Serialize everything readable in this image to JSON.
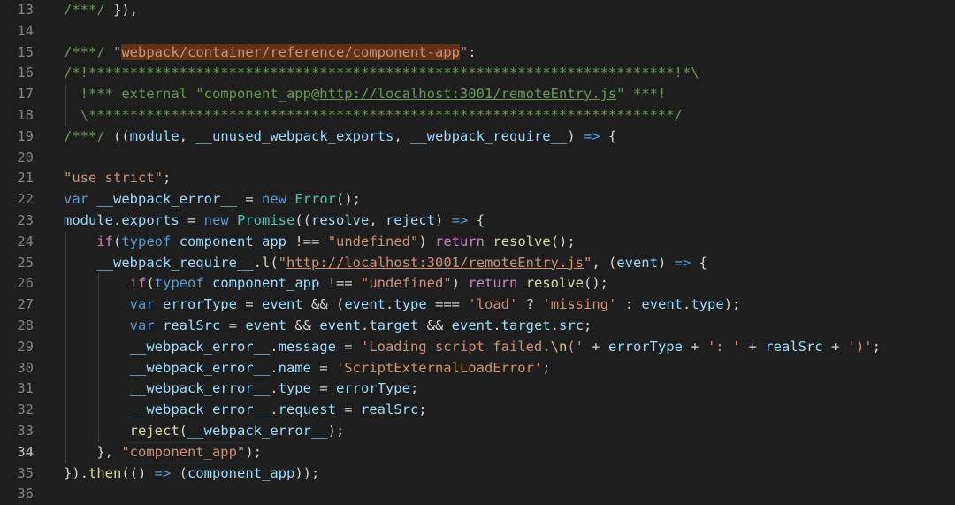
{
  "editor": {
    "lines": [
      {
        "n": "13",
        "parts": [
          [
            "c",
            "/***/ "
          ],
          [
            "p",
            "}),"
          ]
        ]
      },
      {
        "n": "14",
        "parts": []
      },
      {
        "n": "15",
        "parts": [
          [
            "c",
            "/***/ "
          ],
          [
            "s",
            "\""
          ],
          [
            "s hl",
            "webpack/container/reference/component-app"
          ],
          [
            "s",
            "\""
          ],
          [
            "p",
            ":"
          ]
        ]
      },
      {
        "n": "16",
        "parts": [
          [
            "c",
            "/*!***********************************************************************!*\\"
          ]
        ]
      },
      {
        "n": "17",
        "parts": [
          [
            "c",
            "  !*** external \"component_app@"
          ],
          [
            "c u",
            "http://localhost:3001/remoteEntry.js"
          ],
          [
            "c",
            "\" ***!"
          ]
        ]
      },
      {
        "n": "18",
        "parts": [
          [
            "c",
            "  \\***********************************************************************/"
          ]
        ]
      },
      {
        "n": "19",
        "parts": [
          [
            "c",
            "/***/ "
          ],
          [
            "p",
            "(("
          ],
          [
            "v",
            "module"
          ],
          [
            "p",
            ", "
          ],
          [
            "v",
            "__unused_webpack_exports"
          ],
          [
            "p",
            ", "
          ],
          [
            "v",
            "__webpack_require__"
          ],
          [
            "p",
            ") "
          ],
          [
            "k",
            "=>"
          ],
          [
            "p",
            " {"
          ]
        ]
      },
      {
        "n": "20",
        "parts": []
      },
      {
        "n": "21",
        "parts": [
          [
            "s",
            "\"use strict\""
          ],
          [
            "p",
            ";"
          ]
        ]
      },
      {
        "n": "22",
        "parts": [
          [
            "k",
            "var"
          ],
          [
            "p",
            " "
          ],
          [
            "v",
            "__webpack_error__"
          ],
          [
            "p",
            " = "
          ],
          [
            "k",
            "new"
          ],
          [
            "p",
            " "
          ],
          [
            "t",
            "Error"
          ],
          [
            "p",
            "();"
          ]
        ]
      },
      {
        "n": "23",
        "parts": [
          [
            "v",
            "module"
          ],
          [
            "p",
            "."
          ],
          [
            "v",
            "exports"
          ],
          [
            "p",
            " = "
          ],
          [
            "k",
            "new"
          ],
          [
            "p",
            " "
          ],
          [
            "t",
            "Promise"
          ],
          [
            "p",
            "(("
          ],
          [
            "v",
            "resolve"
          ],
          [
            "p",
            ", "
          ],
          [
            "v",
            "reject"
          ],
          [
            "p",
            ") "
          ],
          [
            "k",
            "=>"
          ],
          [
            "p",
            " {"
          ]
        ]
      },
      {
        "n": "24",
        "parts": [
          [
            "p",
            "    "
          ],
          [
            "ctl",
            "if"
          ],
          [
            "p",
            "("
          ],
          [
            "k",
            "typeof"
          ],
          [
            "p",
            " "
          ],
          [
            "v",
            "component_app"
          ],
          [
            "p",
            " !== "
          ],
          [
            "s",
            "\"undefined\""
          ],
          [
            "p",
            ") "
          ],
          [
            "ctl",
            "return"
          ],
          [
            "p",
            " "
          ],
          [
            "f",
            "resolve"
          ],
          [
            "p",
            "();"
          ]
        ]
      },
      {
        "n": "25",
        "parts": [
          [
            "p",
            "    "
          ],
          [
            "v",
            "__webpack_require__"
          ],
          [
            "p",
            "."
          ],
          [
            "f",
            "l"
          ],
          [
            "p",
            "("
          ],
          [
            "s",
            "\""
          ],
          [
            "s u",
            "http://localhost:3001/remoteEntry.js"
          ],
          [
            "s",
            "\""
          ],
          [
            "p",
            ", ("
          ],
          [
            "v",
            "event"
          ],
          [
            "p",
            ") "
          ],
          [
            "k",
            "=>"
          ],
          [
            "p",
            " {"
          ]
        ]
      },
      {
        "n": "26",
        "parts": [
          [
            "p",
            "        "
          ],
          [
            "ctl",
            "if"
          ],
          [
            "p",
            "("
          ],
          [
            "k",
            "typeof"
          ],
          [
            "p",
            " "
          ],
          [
            "v",
            "component_app"
          ],
          [
            "p",
            " !== "
          ],
          [
            "s",
            "\"undefined\""
          ],
          [
            "p",
            ") "
          ],
          [
            "ctl",
            "return"
          ],
          [
            "p",
            " "
          ],
          [
            "f",
            "resolve"
          ],
          [
            "p",
            "();"
          ]
        ]
      },
      {
        "n": "27",
        "parts": [
          [
            "p",
            "        "
          ],
          [
            "k",
            "var"
          ],
          [
            "p",
            " "
          ],
          [
            "v",
            "errorType"
          ],
          [
            "p",
            " = "
          ],
          [
            "v",
            "event"
          ],
          [
            "p",
            " && ("
          ],
          [
            "v",
            "event"
          ],
          [
            "p",
            "."
          ],
          [
            "v",
            "type"
          ],
          [
            "p",
            " === "
          ],
          [
            "s",
            "'load'"
          ],
          [
            "p",
            " ? "
          ],
          [
            "s",
            "'missing'"
          ],
          [
            "p",
            " : "
          ],
          [
            "v",
            "event"
          ],
          [
            "p",
            "."
          ],
          [
            "v",
            "type"
          ],
          [
            "p",
            ");"
          ]
        ]
      },
      {
        "n": "28",
        "parts": [
          [
            "p",
            "        "
          ],
          [
            "k",
            "var"
          ],
          [
            "p",
            " "
          ],
          [
            "v",
            "realSrc"
          ],
          [
            "p",
            " = "
          ],
          [
            "v",
            "event"
          ],
          [
            "p",
            " && "
          ],
          [
            "v",
            "event"
          ],
          [
            "p",
            "."
          ],
          [
            "v",
            "target"
          ],
          [
            "p",
            " && "
          ],
          [
            "v",
            "event"
          ],
          [
            "p",
            "."
          ],
          [
            "v",
            "target"
          ],
          [
            "p",
            "."
          ],
          [
            "v",
            "src"
          ],
          [
            "p",
            ";"
          ]
        ]
      },
      {
        "n": "29",
        "parts": [
          [
            "p",
            "        "
          ],
          [
            "v",
            "__webpack_error__"
          ],
          [
            "p",
            "."
          ],
          [
            "v",
            "message"
          ],
          [
            "p",
            " = "
          ],
          [
            "s",
            "'Loading script failed."
          ],
          [
            "esc",
            "\\n"
          ],
          [
            "s",
            "('"
          ],
          [
            "p",
            " + "
          ],
          [
            "v",
            "errorType"
          ],
          [
            "p",
            " + "
          ],
          [
            "s",
            "': '"
          ],
          [
            "p",
            " + "
          ],
          [
            "v",
            "realSrc"
          ],
          [
            "p",
            " + "
          ],
          [
            "s",
            "')'"
          ],
          [
            "p",
            ";"
          ]
        ]
      },
      {
        "n": "30",
        "parts": [
          [
            "p",
            "        "
          ],
          [
            "v",
            "__webpack_error__"
          ],
          [
            "p",
            "."
          ],
          [
            "v",
            "name"
          ],
          [
            "p",
            " = "
          ],
          [
            "s",
            "'ScriptExternalLoadError'"
          ],
          [
            "p",
            ";"
          ]
        ]
      },
      {
        "n": "31",
        "parts": [
          [
            "p",
            "        "
          ],
          [
            "v",
            "__webpack_error__"
          ],
          [
            "p",
            "."
          ],
          [
            "v",
            "type"
          ],
          [
            "p",
            " = "
          ],
          [
            "v",
            "errorType"
          ],
          [
            "p",
            ";"
          ]
        ]
      },
      {
        "n": "32",
        "parts": [
          [
            "p",
            "        "
          ],
          [
            "v",
            "__webpack_error__"
          ],
          [
            "p",
            "."
          ],
          [
            "v",
            "request"
          ],
          [
            "p",
            " = "
          ],
          [
            "v",
            "realSrc"
          ],
          [
            "p",
            ";"
          ]
        ]
      },
      {
        "n": "33",
        "parts": [
          [
            "p",
            "        "
          ],
          [
            "f",
            "reject"
          ],
          [
            "p",
            "("
          ],
          [
            "v",
            "__webpack_error__"
          ],
          [
            "p",
            ");"
          ]
        ]
      },
      {
        "n": "34",
        "parts": [
          [
            "p",
            "    }, "
          ],
          [
            "s",
            "\"component_app\""
          ],
          [
            "p",
            ");"
          ]
        ],
        "current": true
      },
      {
        "n": "35",
        "parts": [
          [
            "p",
            "})."
          ],
          [
            "f",
            "then"
          ],
          [
            "p",
            "(() "
          ],
          [
            "k",
            "=>"
          ],
          [
            "p",
            " ("
          ],
          [
            "v",
            "component_app"
          ],
          [
            "p",
            "));"
          ]
        ]
      },
      {
        "n": "36",
        "parts": []
      }
    ]
  },
  "colors": {
    "background": "#1e1e1e",
    "comment": "#6a9955",
    "string": "#ce9178",
    "keyword": "#569cd6",
    "control": "#c586c0",
    "variable": "#9cdcfe",
    "function": "#dcdcaa",
    "type": "#4ec9b0",
    "highlight": "#613214"
  }
}
